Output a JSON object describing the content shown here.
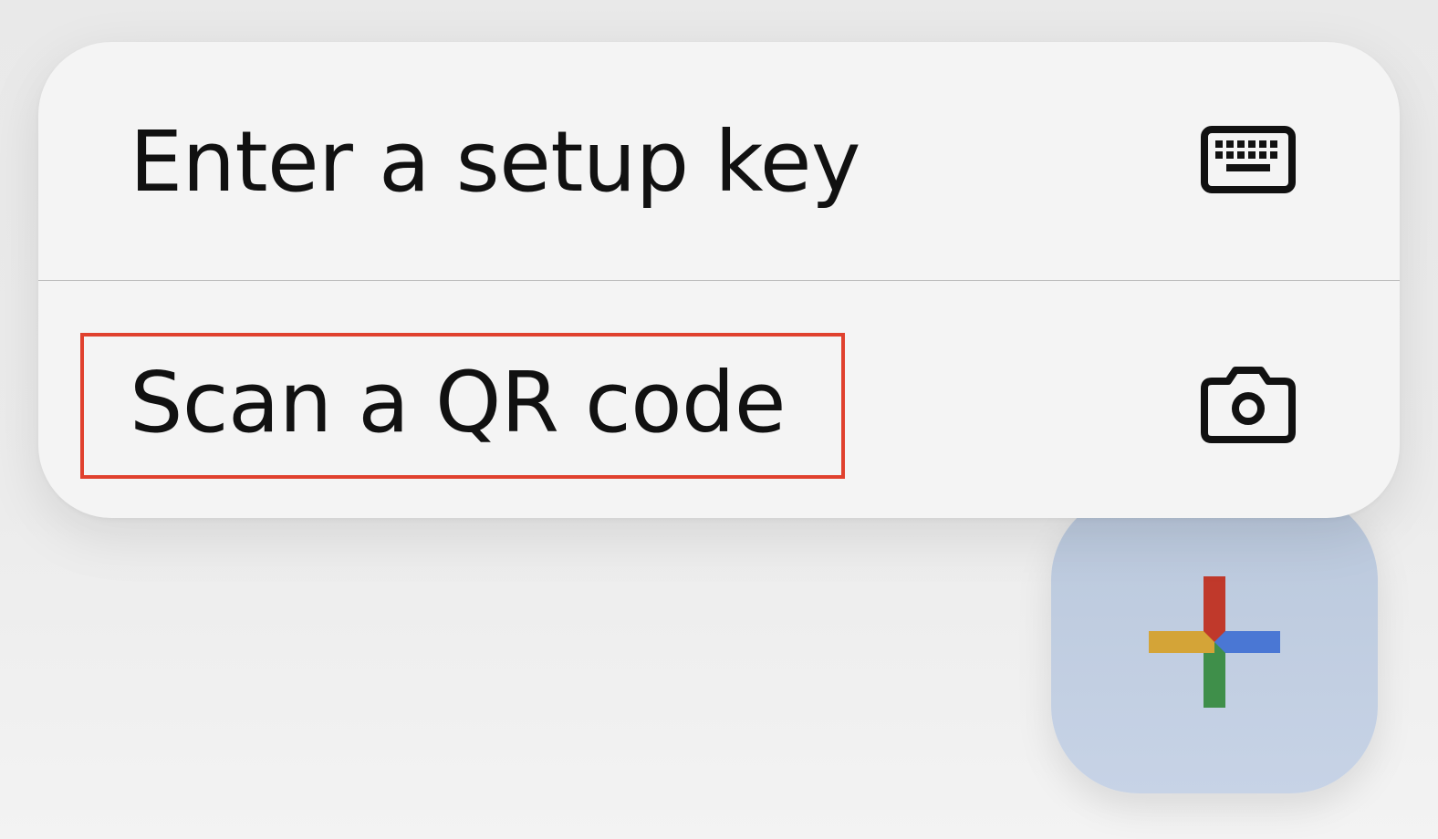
{
  "menu": {
    "items": [
      {
        "label": "Enter a setup key",
        "icon": "keyboard-icon"
      },
      {
        "label": "Scan a QR code",
        "icon": "camera-icon",
        "highlighted": true
      }
    ]
  },
  "fab": {
    "icon": "plus-icon",
    "colors": {
      "top": "#c0392b",
      "right": "#4a77d4",
      "bottom": "#3f8f4a",
      "left": "#d4a437"
    }
  },
  "colors": {
    "highlight_border": "#e0412e",
    "menu_background": "#f4f4f4",
    "fab_background": "#c3d0e3"
  }
}
